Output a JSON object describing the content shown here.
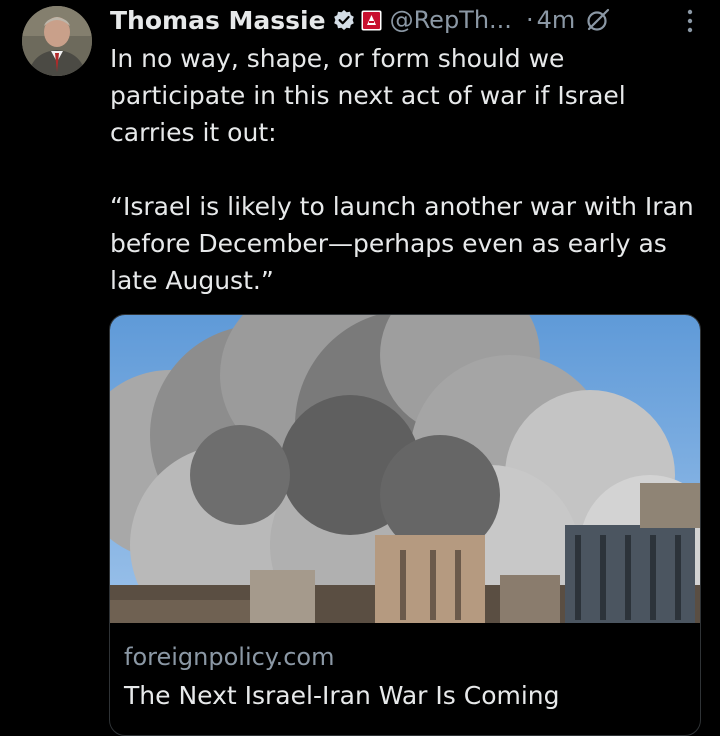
{
  "tweet": {
    "author_name": "Thomas Massie",
    "handle": "@RepTh...",
    "separator": "·",
    "time_ago": "4m",
    "text": "In no way, shape, or form should we\nparticipate in this next act of war if Israel\ncarries it out:\n\n“Israel is likely to launch another war with Iran\nbefore December—perhaps even as early as\nlate August.”"
  },
  "icons": {
    "verified": "verified-badge-icon",
    "affiliation": "us-house-flag-icon",
    "grok": "grok-icon",
    "more": "more-options-icon"
  },
  "link_card": {
    "domain": "foreignpolicy.com",
    "title": "The Next Israel-Iran War Is Coming"
  },
  "colors": {
    "background": "#000000",
    "text": "#e7e9ea",
    "secondary": "#8b98a5",
    "verified": "#d4dde6"
  }
}
